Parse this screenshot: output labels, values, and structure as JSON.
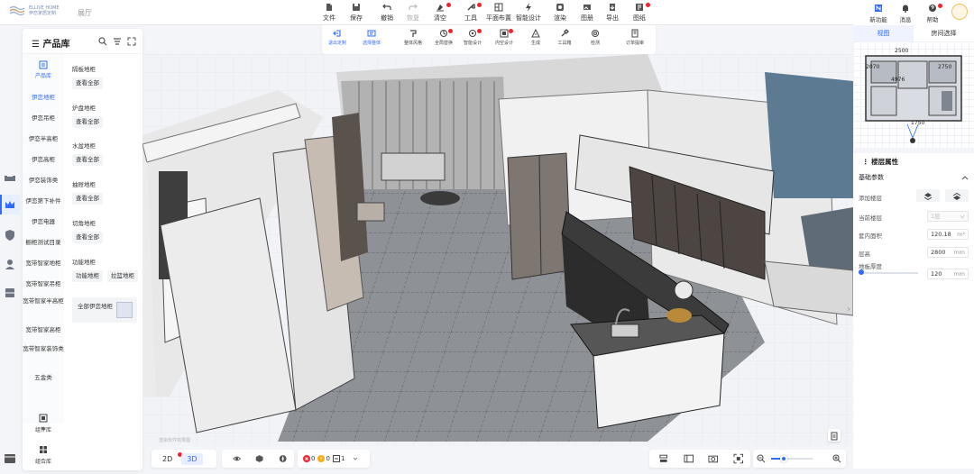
{
  "brand": {
    "logo_line1": "ELLIVE HOME",
    "logo_line2": "伊恋家居定制",
    "project_name": "展厅"
  },
  "colors": {
    "accent": "#2f6bff",
    "alert": "#f5222d",
    "floor": "#8e9297",
    "wall_top": "#f4f4f4"
  },
  "toolbar": {
    "items": [
      {
        "label": "文件",
        "icon": "file-icon"
      },
      {
        "label": "保存",
        "icon": "save-icon"
      },
      {
        "label": "撤销",
        "icon": "undo-icon"
      },
      {
        "label": "恢复",
        "icon": "redo-icon",
        "disabled": true
      },
      {
        "label": "清空",
        "icon": "clear-icon"
      },
      {
        "label": "工具",
        "icon": "wrench-icon"
      },
      {
        "label": "平面布置",
        "icon": "layout-icon"
      },
      {
        "label": "智能设计",
        "icon": "lightning-icon"
      },
      {
        "label": "渲染",
        "icon": "render-icon"
      },
      {
        "label": "图册",
        "icon": "album-icon"
      },
      {
        "label": "导出",
        "icon": "export-icon"
      },
      {
        "label": "图纸",
        "icon": "drawing-icon"
      }
    ]
  },
  "subtoolbar": {
    "items": [
      {
        "label": "退出定制",
        "icon": "exit-icon",
        "active": true
      },
      {
        "label": "选择整体",
        "icon": "select-all-icon",
        "active": true
      },
      {
        "label": "整体风格",
        "icon": "style-icon"
      },
      {
        "label": "全局替换",
        "icon": "replace-icon"
      },
      {
        "label": "智能设计",
        "icon": "smart-design-icon"
      },
      {
        "label": "内空设计",
        "icon": "interior-icon"
      },
      {
        "label": "生成",
        "icon": "generate-icon"
      },
      {
        "label": "工具箱",
        "icon": "toolbox-icon"
      },
      {
        "label": "检测",
        "icon": "check-icon"
      },
      {
        "label": "订单提审",
        "icon": "order-icon"
      }
    ]
  },
  "right_header": {
    "items": [
      {
        "label": "新功能",
        "icon": "new-feature-icon"
      },
      {
        "label": "消息",
        "icon": "bell-icon"
      },
      {
        "label": "帮助",
        "icon": "help-icon"
      }
    ]
  },
  "library": {
    "title": "产品库",
    "tab_label": "产品库",
    "categories": [
      "伊恋地柜",
      "伊恋吊柜",
      "伊恋半高柜",
      "伊恋高柜",
      "伊恋装饰类",
      "伊恋第下补件",
      "伊恋电器",
      "橱柜测试目录",
      "宽带智家地柜",
      "宽带智家吊柜",
      "宽带智家半高柜",
      "宽带智家高柜",
      "宽带智家装饰类",
      "五金类"
    ],
    "active_category": "伊恋地柜",
    "subgroups": [
      {
        "title": "隔板地柜",
        "chips": [
          "查看全部"
        ]
      },
      {
        "title": "炉盘地柜",
        "chips": [
          "查看全部"
        ]
      },
      {
        "title": "水盆地柜",
        "chips": [
          "查看全部"
        ]
      },
      {
        "title": "抽屉地柜",
        "chips": [
          "查看全部"
        ]
      },
      {
        "title": "切角地柜",
        "chips": [
          "查看全部"
        ]
      },
      {
        "title": "功能地柜",
        "chips": [
          "功能地柜",
          "拉篮地柜"
        ]
      }
    ],
    "all_item": "全部伊恋地柜",
    "bottom": [
      {
        "label": "组件库",
        "icon": "component-icon"
      },
      {
        "label": "组合库",
        "icon": "combo-icon"
      }
    ]
  },
  "canvas": {
    "watermark": "渲染软件效果图"
  },
  "bottom_bar": {
    "modes": [
      "2D",
      "3D"
    ],
    "active_mode": "3D",
    "counts": {
      "errors": "0",
      "warnings": "0",
      "info": "1"
    },
    "zoom": 0.3
  },
  "minimap": {
    "tabs": [
      "视图",
      "房间选择"
    ],
    "active_tab": "视图",
    "dims": {
      "top": "2500",
      "left": "2070",
      "middle": "4976",
      "right": "2750",
      "bottom": "1750"
    }
  },
  "properties": {
    "title": "楼层属性",
    "section": "基础参数",
    "rows": [
      {
        "label": "添加楼层",
        "type": "buttons"
      },
      {
        "label": "当前楼层",
        "value": "1层",
        "disabled": true
      },
      {
        "label": "套内面积",
        "value": "120.18",
        "unit": "m²"
      },
      {
        "label": "层高",
        "value": "2800",
        "unit": "mm"
      },
      {
        "label": "地板厚度",
        "value": "120",
        "unit": "mm"
      }
    ],
    "slider": 0.05
  }
}
